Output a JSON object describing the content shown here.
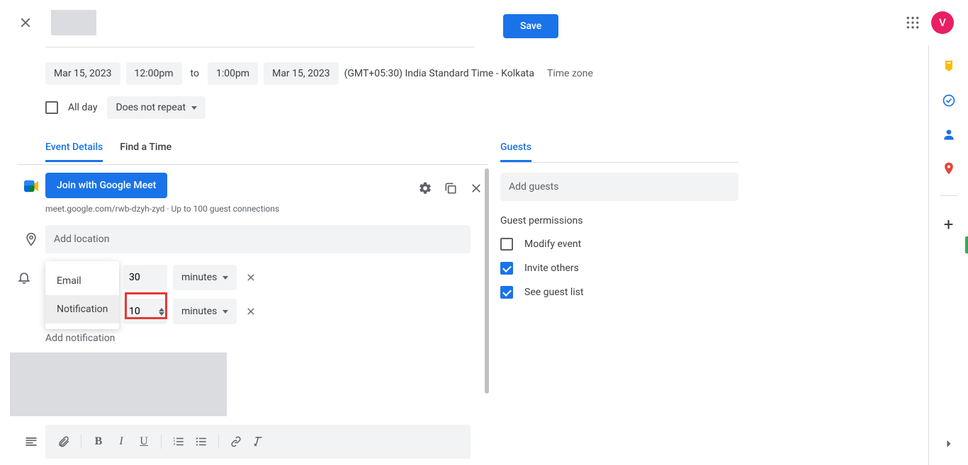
{
  "topbar": {
    "save_label": "Save",
    "avatar_initial": "V"
  },
  "datetime": {
    "start_date": "Mar 15, 2023",
    "start_time": "12:00pm",
    "to": "to",
    "end_time": "1:00pm",
    "end_date": "Mar 15, 2023",
    "timezone_info": "(GMT+05:30) India Standard Time - Kolkata",
    "timezone_link": "Time zone"
  },
  "allday": {
    "label": "All day",
    "repeat": "Does not repeat"
  },
  "tabs": {
    "event_details": "Event Details",
    "find_time": "Find a Time"
  },
  "meet": {
    "join_label": "Join with Google Meet",
    "link_text": "meet.google.com/rwb-dzyh-zyd · Up to 100 guest connections"
  },
  "location": {
    "placeholder": "Add location"
  },
  "notifications": {
    "row1": {
      "value": "30",
      "unit": "minutes"
    },
    "row2": {
      "value": "10",
      "unit": "minutes"
    },
    "dropdown": {
      "email": "Email",
      "notification": "Notification"
    },
    "add_link": "Add notification"
  },
  "guests": {
    "title": "Guests",
    "input_placeholder": "Add guests",
    "permissions_title": "Guest permissions",
    "perm_modify": "Modify event",
    "perm_invite": "Invite others",
    "perm_see": "See guest list"
  }
}
